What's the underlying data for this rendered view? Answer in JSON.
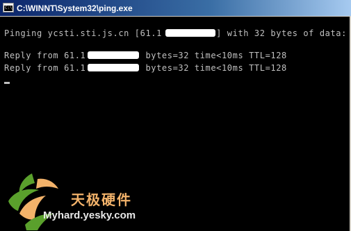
{
  "window": {
    "title": "C:\\WINNT\\System32\\ping.exe",
    "icon_label": "C:\\"
  },
  "console": {
    "line1": "Pinging ycsti.sti.js.cn [61.1          ] with 32 bytes of data:",
    "line2": "Reply from 61.1         : bytes=32 time<10ms TTL=128",
    "line3": "Reply from 61.1         : bytes=32 time<10ms TTL=128"
  },
  "watermark": {
    "brand_cn": "天极硬件",
    "url": "Myhard.yesky.com"
  },
  "colors": {
    "console_bg": "#000000",
    "console_text": "#c0c0c0",
    "titlebar_start": "#0a246a",
    "titlebar_end": "#a6caf0",
    "watermark_orange": "#f2b26a",
    "watermark_green": "#5aa02c"
  },
  "icons": {
    "window": "console-window-icon",
    "logo": "yesky-swirl-logo-icon"
  }
}
